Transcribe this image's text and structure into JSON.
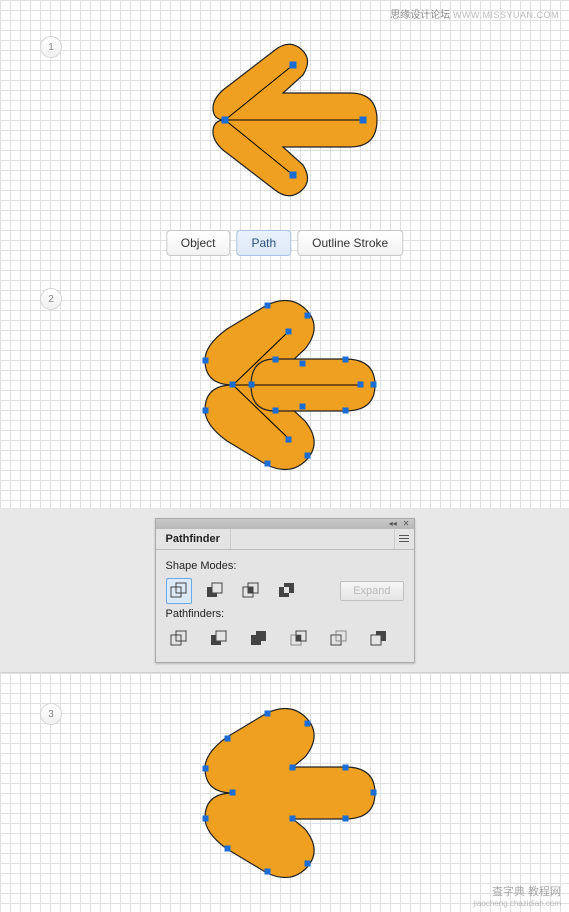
{
  "watermark_top": {
    "main": "思缘设计论坛",
    "sub": "WWW.MISSYUAN.COM"
  },
  "watermark_bottom": {
    "main": "查字典 教程网",
    "sub": "jiaocheng.chazidian.com"
  },
  "steps": {
    "one": "1",
    "two": "2",
    "three": "3"
  },
  "menu": {
    "object": "Object",
    "path": "Path",
    "outline_stroke": "Outline Stroke"
  },
  "pathfinder": {
    "tab": "Pathfinder",
    "shape_modes_label": "Shape Modes:",
    "pathfinders_label": "Pathfinders:",
    "expand": "Expand",
    "shape_modes": [
      "unite",
      "minus-front",
      "intersect",
      "exclude"
    ],
    "pathfinders": [
      "divide",
      "trim",
      "merge",
      "crop",
      "outline",
      "minus-back"
    ]
  },
  "arrow": {
    "fill": "#f0a020",
    "stroke": "#222"
  }
}
